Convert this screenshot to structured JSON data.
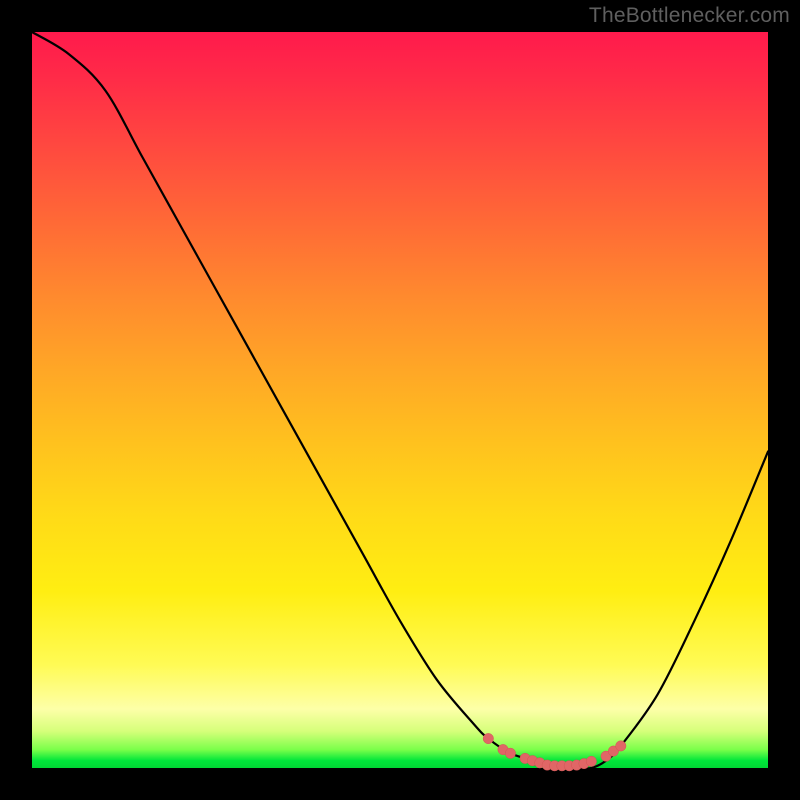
{
  "watermark": "TheBottlenecker.com",
  "colors": {
    "curve": "#000000",
    "marker": "#e06666",
    "gradient_top": "#ff1a4c",
    "gradient_bottom": "#00d634"
  },
  "chart_data": {
    "type": "line",
    "title": "",
    "xlabel": "",
    "ylabel": "",
    "xlim": [
      0,
      100
    ],
    "ylim": [
      0,
      100
    ],
    "x": [
      0,
      5,
      10,
      15,
      20,
      25,
      30,
      35,
      40,
      45,
      50,
      55,
      60,
      62,
      65,
      68,
      70,
      72,
      74,
      76,
      78,
      80,
      85,
      90,
      95,
      100
    ],
    "values": [
      100,
      97,
      92,
      83,
      74,
      65,
      56,
      47,
      38,
      29,
      20,
      12,
      6,
      4,
      2,
      1,
      0,
      0,
      0,
      0,
      1,
      3,
      10,
      20,
      31,
      43
    ],
    "markers_x": [
      62,
      64,
      65,
      67,
      68,
      69,
      70,
      71,
      72,
      73,
      74,
      75,
      76,
      78,
      79,
      80
    ],
    "markers_y": [
      4,
      2.5,
      2,
      1.3,
      1,
      0.7,
      0.4,
      0.3,
      0.3,
      0.3,
      0.4,
      0.6,
      0.9,
      1.6,
      2.3,
      3
    ]
  }
}
